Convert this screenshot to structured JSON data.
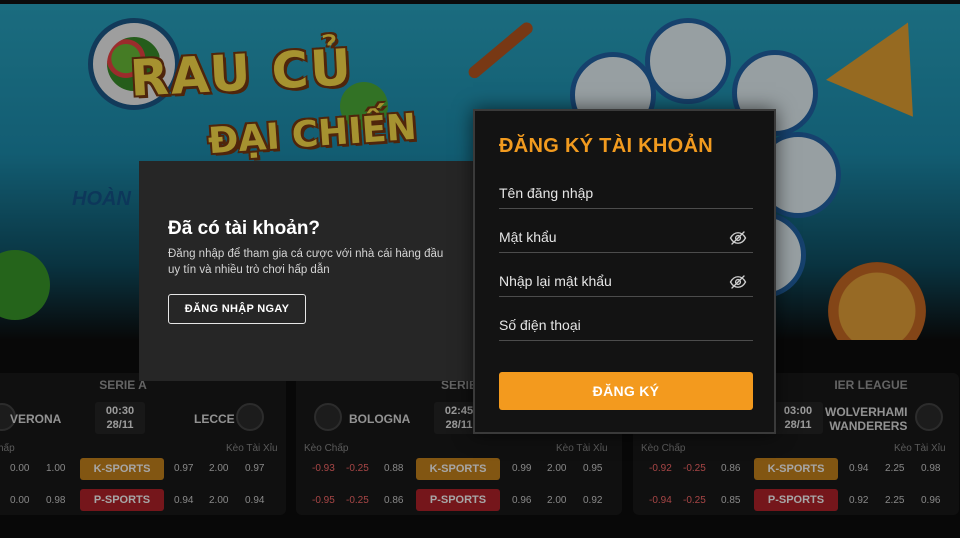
{
  "banner": {
    "logo_line1": "RAU CỦ",
    "logo_line2": "ĐẠI CHIẾN",
    "partial_text": "HOÀN"
  },
  "login_panel": {
    "title": "Đã có tài khoản?",
    "description": "Đăng nhập để tham gia cá cược với nhà cái hàng đầu uy tín và nhiều trò chơi hấp dẫn",
    "button": "ĐĂNG NHẬP NGAY"
  },
  "register_modal": {
    "title": "ĐĂNG KÝ TÀI KHOẢN",
    "fields": [
      {
        "label": "Tên đăng nhập",
        "has_eye": false
      },
      {
        "label": "Mật khẩu",
        "has_eye": true,
        "icon": "eye-off-icon"
      },
      {
        "label": "Nhập lại mật khẩu",
        "has_eye": true,
        "icon": "eye-off-icon"
      },
      {
        "label": "Số điện thoại",
        "has_eye": false
      }
    ],
    "submit": "ĐĂNG KÝ"
  },
  "matches": [
    {
      "league": "SERIE A",
      "home": "VERONA",
      "away": "LECCE",
      "time": "00:30",
      "date": "28/11",
      "handicap_label": "hấp",
      "ou_label": "Kèo Tài Xỉu",
      "k_row": {
        "h": [
          "0.00",
          "1.00"
        ],
        "ou": [
          "0.97",
          "2.00",
          "0.97"
        ]
      },
      "p_row": {
        "h": [
          "0.00",
          "0.98"
        ],
        "ou": [
          "0.94",
          "2.00",
          "0.94"
        ]
      }
    },
    {
      "league": "SERIE",
      "home": "BOLOGNA",
      "away": "",
      "time": "02:45",
      "date": "28/11",
      "handicap_label": "Kèo Chấp",
      "ou_label": "Kèo Tài Xỉu",
      "k_row": {
        "h": [
          "-0.93",
          "-0.25",
          "0.88"
        ],
        "ou": [
          "0.99",
          "2.00",
          "0.95"
        ]
      },
      "p_row": {
        "h": [
          "-0.95",
          "-0.25",
          "0.86"
        ],
        "ou": [
          "0.96",
          "2.00",
          "0.92"
        ]
      }
    },
    {
      "league": "IER LEAGUE",
      "home": "",
      "away_line1": "WOLVERHAMI",
      "away_line2": "WANDERERS",
      "time": "03:00",
      "date": "28/11",
      "handicap_label": "Kèo Chấp",
      "ou_label": "Kèo Tài Xỉu",
      "k_row": {
        "h": [
          "-0.92",
          "-0.25",
          "0.86"
        ],
        "ou": [
          "0.94",
          "2.25",
          "0.98"
        ]
      },
      "p_row": {
        "h": [
          "-0.94",
          "-0.25",
          "0.85"
        ],
        "ou": [
          "0.92",
          "2.25",
          "0.96"
        ]
      }
    }
  ],
  "sport_buttons": {
    "k": "K-SPORTS",
    "p": "P-SPORTS"
  },
  "colors": {
    "accent": "#f39a1e",
    "title_orange": "#f29b1f",
    "k_sports": "#c8841c",
    "p_sports": "#b4222a",
    "negative": "#ff6b6b"
  }
}
